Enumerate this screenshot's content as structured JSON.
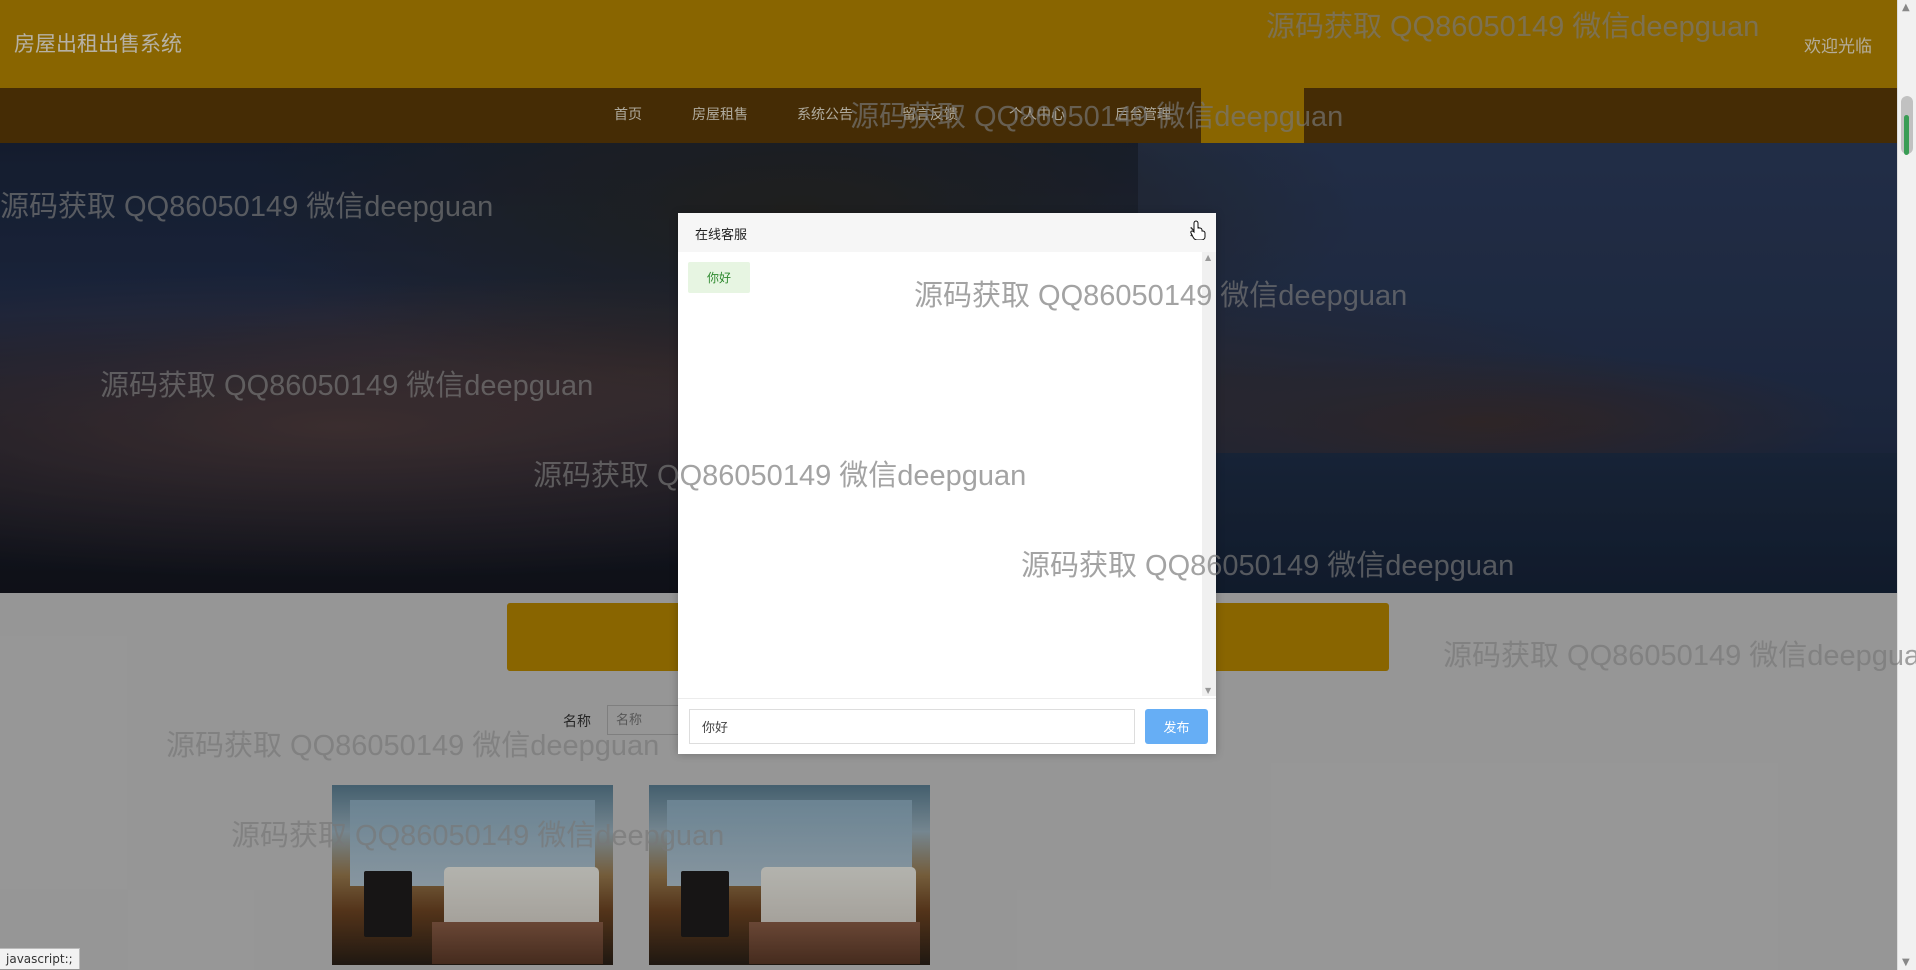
{
  "header": {
    "site_title": "房屋出租出售系统",
    "welcome_text": "欢迎光临"
  },
  "nav": {
    "items": [
      "首页",
      "房屋租售",
      "系统公告",
      "留言反馈",
      "个人中心",
      "后台管理"
    ]
  },
  "search": {
    "label": "名称",
    "placeholder": "名称"
  },
  "chat": {
    "title": "在线客服",
    "messages": [
      "你好"
    ],
    "input_value": "你好",
    "send_label": "发布"
  },
  "watermark_text": "源码获取 QQ86050149 微信deepguan",
  "status_bar_text": "javascript:;",
  "icons": {
    "close": "close-icon",
    "cursor": "pointer-hand-icon",
    "scroll_up": "triangle-up-icon",
    "scroll_down": "triangle-down-icon"
  },
  "colors": {
    "topbar": "#b78700",
    "navbar": "#5c3b07",
    "send_button": "#66aef5"
  }
}
